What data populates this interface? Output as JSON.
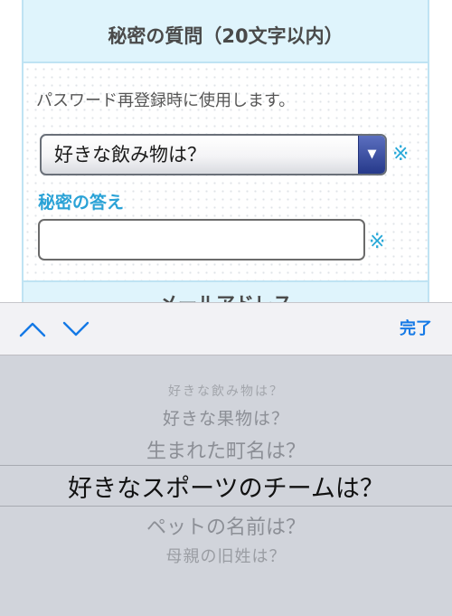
{
  "form": {
    "section_title": "秘密の質問（20文字以内）",
    "helper_text": "パスワード再登録時に使用します。",
    "select_value": "好きな飲み物は？",
    "select_arrow": "▼",
    "required_mark": "※",
    "answer_label": "秘密の答え",
    "answer_value": "",
    "next_section_title": "メールアドレス"
  },
  "accessory": {
    "done_label": "完了"
  },
  "picker": {
    "options": [
      "好きな飲み物は？",
      "好きな果物は？",
      "生まれた町名は？",
      "好きなスポーツのチームは？",
      "ペットの名前は？",
      "母親の旧姓は？"
    ],
    "selected_index": 3
  },
  "colors": {
    "accent": "#2aa2d6",
    "ios_blue": "#1479e6",
    "section_bg": "#dff4fc",
    "picker_bg": "#d1d4db"
  }
}
